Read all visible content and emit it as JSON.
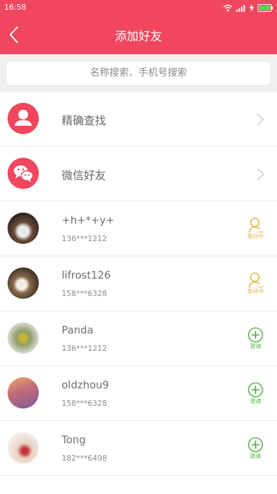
{
  "status_bar": {
    "time": "16:58"
  },
  "header": {
    "title": "添加好友"
  },
  "search": {
    "placeholder": "名称搜索、手机号搜索"
  },
  "options": [
    {
      "label": "精确查找",
      "icon": "person-icon"
    },
    {
      "label": "微信好友",
      "icon": "wechat-icon"
    }
  ],
  "contacts": [
    {
      "name": "+h+*+y+",
      "phone": "136***1212",
      "action": "等待中"
    },
    {
      "name": "lifrost126",
      "phone": "158***6328",
      "action": "等待中"
    },
    {
      "name": "Panda",
      "phone": "136***1212",
      "action": "邀请"
    },
    {
      "name": "oldzhou9",
      "phone": "158***6328",
      "action": "邀请"
    },
    {
      "name": "Tong",
      "phone": "182***6498",
      "action": "邀请"
    }
  ],
  "colors": {
    "accent": "#f0475e",
    "waiting": "#e2b84a",
    "invite": "#58b54a"
  }
}
